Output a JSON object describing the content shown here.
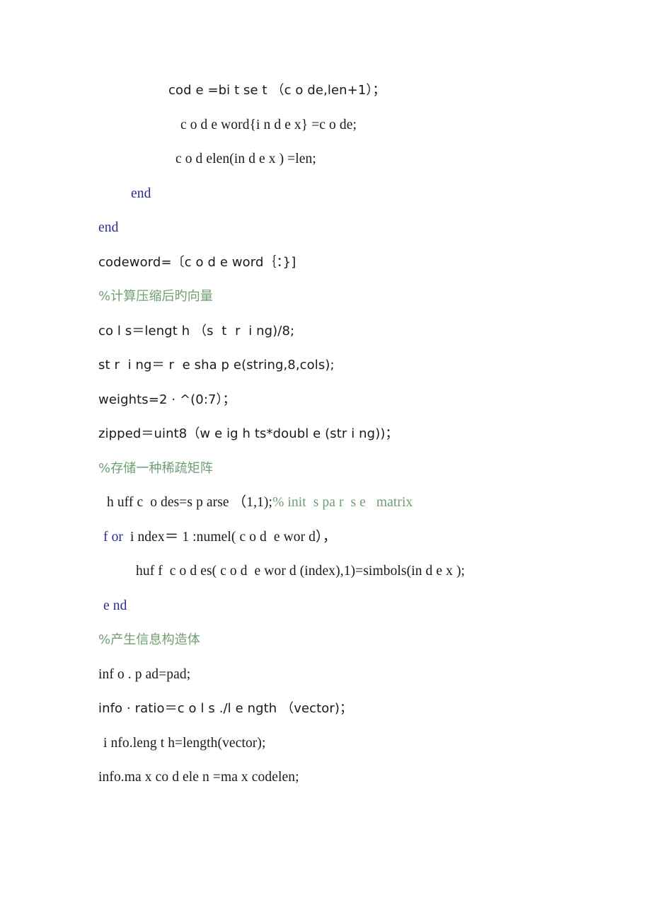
{
  "document": {
    "kind": "code-listing",
    "language": "MATLAB",
    "colors": {
      "text": "#1a1a1a",
      "keyword": "#2a2a96",
      "comment": "#6f9e72",
      "page_background": "#ffffff"
    },
    "lines": [
      {
        "id": "line-1",
        "indent": "i6",
        "style": "plain",
        "text": "cod e =bi t se t （c o de,len+1）；"
      },
      {
        "id": "line-2",
        "indent": "i8",
        "style": "plain",
        "text": "c o d e word{i n d e x} =c o de;"
      },
      {
        "id": "line-3",
        "indent": "i7",
        "style": "plain",
        "text": "c o d elen(in d e x ) =len;"
      },
      {
        "id": "line-4",
        "indent": "i4",
        "style": "keyword",
        "text": "end"
      },
      {
        "id": "line-5",
        "indent": "i0",
        "style": "keyword",
        "text": "end"
      },
      {
        "id": "line-6",
        "indent": "i0",
        "style": "plain",
        "text": "codeword=〔c o d e word｛：}]"
      },
      {
        "id": "line-7",
        "indent": "i0",
        "style": "comment",
        "text": "%计算压缩后旳向量"
      },
      {
        "id": "line-8",
        "indent": "i0",
        "style": "plain",
        "text": "co l s＝lengt h （s  t  r  i ng)/8;"
      },
      {
        "id": "line-9",
        "indent": "i0",
        "style": "plain",
        "text": "st r  i ng＝ r  e sha p e(string,8,cols);"
      },
      {
        "id": "line-10",
        "indent": "i0",
        "style": "plain",
        "text": "weights=2 · ^(0:7）；"
      },
      {
        "id": "line-11",
        "indent": "i0",
        "style": "plain",
        "text": "zipped＝uint8（w e ig h ts*doubl e (str i ng))；"
      },
      {
        "id": "line-12",
        "indent": "i0",
        "style": "comment",
        "text": "%存储一种稀疏矩阵"
      },
      {
        "id": "line-13",
        "indent": "i2",
        "style": "mixed",
        "segments": [
          {
            "kind": "plain",
            "text": "h uff c  o des=s p arse （1,1);"
          },
          {
            "kind": "comment",
            "text": "% init  s pa r  s e   matrix"
          }
        ]
      },
      {
        "id": "line-14",
        "indent": "i1",
        "style": "mixed",
        "segments": [
          {
            "kind": "keyword",
            "text": "f or"
          },
          {
            "kind": "plain",
            "text": "  i ndex＝ 1 :numel( c o d  e wor d），"
          }
        ]
      },
      {
        "id": "line-15",
        "indent": "i5",
        "style": "plain",
        "text": "huf f  c o d es( c o d  e wor d (index),1)=simbols(in d e x );"
      },
      {
        "id": "line-16",
        "indent": "i1",
        "style": "keyword",
        "text": "e nd"
      },
      {
        "id": "line-17",
        "indent": "i0",
        "style": "comment",
        "text": "%产生信息构造体"
      },
      {
        "id": "line-18",
        "indent": "i0",
        "style": "plain",
        "text": "inf o . p ad=pad;"
      },
      {
        "id": "line-19",
        "indent": "i0",
        "style": "plain",
        "text": "info · ratio＝c o l s ./l e ngth （vector)；"
      },
      {
        "id": "line-20",
        "indent": "i1",
        "style": "plain",
        "text": "i nfo.leng t h=length(vector);"
      },
      {
        "id": "line-21",
        "indent": "i0",
        "style": "plain",
        "text": "info.ma x co d ele n =ma x codelen;"
      }
    ]
  }
}
